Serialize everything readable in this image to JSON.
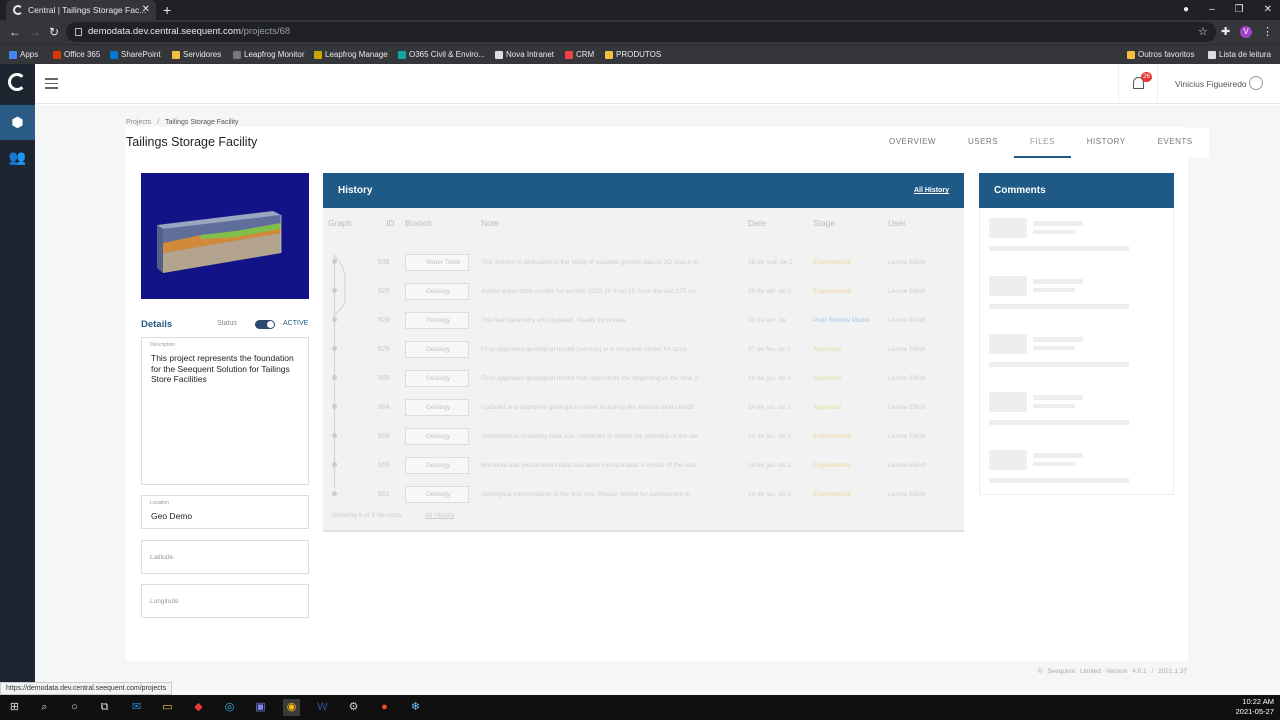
{
  "browser": {
    "tab_title": "Central | Tailings Storage Fac...",
    "tab_close": "✕",
    "new_tab": "+",
    "url_host": "demodata.dev.central.seequent.com",
    "url_path": "/projects/68",
    "status_url": "https://demodata.dev.central.seequent.com/projects",
    "bookmarks": [
      "Apps",
      "Office 365",
      "SharePoint",
      "Servidores",
      "Leapfrog Monitor",
      "Leapfrog Manage",
      "O365 Civil & Enviro...",
      "Nova Intranet",
      "CRM",
      "PRODUTOS"
    ],
    "bookmarks_right": [
      "Outros favoritos",
      "Lista de leitura"
    ],
    "bookmark_colors": [
      "#4285f4",
      "#d83b01",
      "#0078d4",
      "#f0c040",
      "#777",
      "#c6a700",
      "#0fa5a5",
      "#ddd",
      "#e44",
      "#f0c040"
    ],
    "profile_initial": "V"
  },
  "header": {
    "notification_count": "26",
    "user_name": "Vinicius Figueiredo"
  },
  "breadcrumb": {
    "root": "Projects",
    "separator": "/",
    "current": "Tailings Storage Facility"
  },
  "page_title": "Tailings Storage Facility",
  "tabs": [
    "OVERVIEW",
    "USERS",
    "FILES",
    "HISTORY",
    "EVENTS"
  ],
  "selected_tab": "FILES",
  "details": {
    "title": "Details",
    "status_label": "Status",
    "status_value": "ACTIVE",
    "description_label": "Description",
    "description": "This project represents the foundation for the Seequent Solution for Tailings Store Facilities",
    "location_label": "Location",
    "location_value": "Geo Demo",
    "latitude_placeholder": "Latitude",
    "longitude_placeholder": "Longitude"
  },
  "history": {
    "title": "History",
    "all_history_link": "All History",
    "columns": [
      "Graph",
      "ID",
      "Branch",
      "Note",
      "Date",
      "Stage",
      "User"
    ],
    "rows": [
      {
        "id": "638",
        "branch": "Water Table",
        "note": "This branch is dedicated to the study of variable ground data in 3D space to",
        "date": "28 de mai. de 2",
        "stage": "Experimental",
        "stage_color": "#f3d49b",
        "user": "Leonie Elliott"
      },
      {
        "id": "525",
        "branch": "Geology",
        "note": "Added water table results for section 2023 10 from 1D from the last 175 bo",
        "date": "09 de abr. de 2",
        "stage": "Experimental",
        "stage_color": "#f3d49b",
        "user": "Leonie Elliott"
      },
      {
        "id": "828",
        "branch": "Geology",
        "note": "The fault geometry and updated. Ready for review.",
        "date": "03 de abr. de",
        "stage": "Peer Review Model",
        "stage_color": "#a6c8e6",
        "user": "Leonie Elliott"
      },
      {
        "id": "576",
        "branch": "Geology",
        "note": "Final approved geological model (version) in a complete model for acce",
        "date": "27 de fev. de 2",
        "stage": "Approved",
        "stage_color": "#d6e29a",
        "user": "Leonie Elliott"
      },
      {
        "id": "568",
        "branch": "Geology",
        "note": "Final approved geological model that represents the beginning of the final p",
        "date": "16 de jun. de 2",
        "stage": "Approved",
        "stage_color": "#d6e29a",
        "user": "Leonie Elliott"
      },
      {
        "id": "664",
        "branch": "Geology",
        "note": "Updated and approved geological model including the internal fault identifi",
        "date": "14 de jun. de 2",
        "stage": "Approved",
        "stage_color": "#d6e29a",
        "user": "Leonie Elliott"
      },
      {
        "id": "668",
        "branch": "Geology",
        "note": "Geotechnical resistivity data was combined to define the potential of the we",
        "date": "14 de jun. de 2",
        "stage": "Experimental",
        "stage_color": "#f3d49b",
        "user": "Leonie Elliott"
      },
      {
        "id": "555",
        "branch": "Geology",
        "note": "Borehole and piezometers data has been incorporated. A model of the exte",
        "date": "14 de jun. de 2",
        "stage": "Experimental",
        "stage_color": "#f3d49b",
        "user": "Leonie Elliott"
      },
      {
        "id": "661",
        "branch": "Geology",
        "note": "Geological interpretation in the first one. Please review for subsequent m",
        "date": "14 de jun. de 2",
        "stage": "Experimental",
        "stage_color": "#f3d49b",
        "user": "Leonie Elliott"
      }
    ],
    "footer_text": "Showing 9 of 9 Versions",
    "footer_link": "All History"
  },
  "comments": {
    "title": "Comments"
  },
  "footer": {
    "company": "© Seequent Limited",
    "version": "Version 4.0.1 / 2021.1.37"
  },
  "taskbar": {
    "time": "10:22 AM",
    "date": "2021-05-27"
  }
}
